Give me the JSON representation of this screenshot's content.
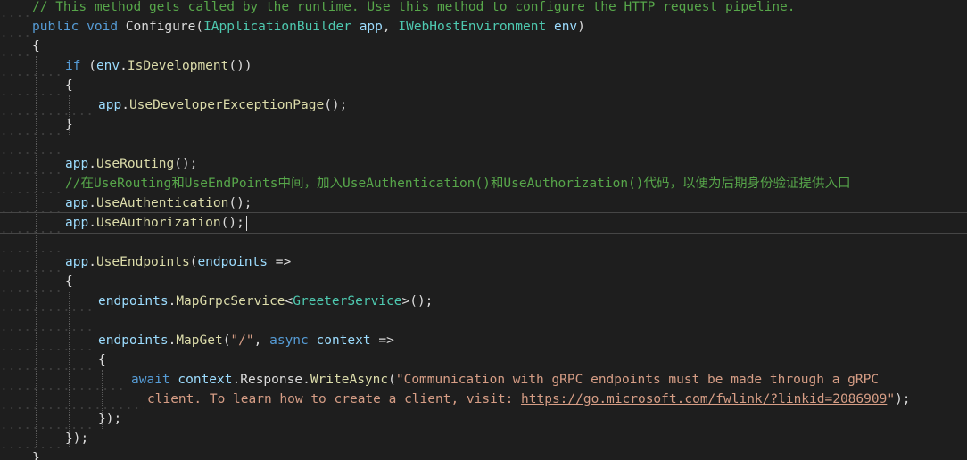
{
  "editor": {
    "lines": [
      {
        "tokens": [
          {
            "t": "// This method gets called by the runtime. Use this method to configure the HTTP request pipeline.",
            "c": "cmt"
          }
        ]
      },
      {
        "tokens": [
          {
            "t": "public",
            "c": "kw"
          },
          {
            "t": " ",
            "c": "punc"
          },
          {
            "t": "void",
            "c": "kw"
          },
          {
            "t": " Configure(",
            "c": "punc"
          },
          {
            "t": "IApplicationBuilder",
            "c": "type"
          },
          {
            "t": " ",
            "c": "punc"
          },
          {
            "t": "app",
            "c": "param"
          },
          {
            "t": ", ",
            "c": "punc"
          },
          {
            "t": "IWebHostEnvironment",
            "c": "type"
          },
          {
            "t": " ",
            "c": "punc"
          },
          {
            "t": "env",
            "c": "param"
          },
          {
            "t": ")",
            "c": "punc"
          }
        ]
      },
      {
        "tokens": [
          {
            "t": "{",
            "c": "punc"
          }
        ]
      },
      {
        "tokens": [
          {
            "t": "if",
            "c": "kw"
          },
          {
            "t": " (",
            "c": "punc"
          },
          {
            "t": "env",
            "c": "param"
          },
          {
            "t": ".",
            "c": "punc"
          },
          {
            "t": "IsDevelopment",
            "c": "method"
          },
          {
            "t": "())",
            "c": "punc"
          }
        ]
      },
      {
        "tokens": [
          {
            "t": "{",
            "c": "punc"
          }
        ]
      },
      {
        "tokens": [
          {
            "t": "app",
            "c": "param"
          },
          {
            "t": ".",
            "c": "punc"
          },
          {
            "t": "UseDeveloperExceptionPage",
            "c": "method"
          },
          {
            "t": "();",
            "c": "punc"
          }
        ]
      },
      {
        "tokens": [
          {
            "t": "}",
            "c": "punc"
          }
        ]
      },
      {
        "tokens": []
      },
      {
        "tokens": [
          {
            "t": "app",
            "c": "param"
          },
          {
            "t": ".",
            "c": "punc"
          },
          {
            "t": "UseRouting",
            "c": "method"
          },
          {
            "t": "();",
            "c": "punc"
          }
        ]
      },
      {
        "tokens": [
          {
            "t": "//在UseRouting和UseEndPoints中间，加入UseAuthentication()和UseAuthorization()代码，以便为后期身份验证提供入口",
            "c": "cmt"
          }
        ]
      },
      {
        "tokens": [
          {
            "t": "app",
            "c": "param"
          },
          {
            "t": ".",
            "c": "punc"
          },
          {
            "t": "UseAuthentication",
            "c": "method"
          },
          {
            "t": "();",
            "c": "punc"
          }
        ]
      },
      {
        "tokens": [
          {
            "t": "app",
            "c": "param"
          },
          {
            "t": ".",
            "c": "punc"
          },
          {
            "t": "UseAuthorization",
            "c": "method"
          },
          {
            "t": "();",
            "c": "punc"
          }
        ]
      },
      {
        "tokens": []
      },
      {
        "tokens": [
          {
            "t": "app",
            "c": "param"
          },
          {
            "t": ".",
            "c": "punc"
          },
          {
            "t": "UseEndpoints",
            "c": "method"
          },
          {
            "t": "(",
            "c": "punc"
          },
          {
            "t": "endpoints",
            "c": "param"
          },
          {
            "t": " =>",
            "c": "punc"
          }
        ]
      },
      {
        "tokens": [
          {
            "t": "{",
            "c": "punc"
          }
        ]
      },
      {
        "tokens": [
          {
            "t": "endpoints",
            "c": "param"
          },
          {
            "t": ".",
            "c": "punc"
          },
          {
            "t": "MapGrpcService",
            "c": "method"
          },
          {
            "t": "<",
            "c": "punc"
          },
          {
            "t": "GreeterService",
            "c": "type"
          },
          {
            "t": ">();",
            "c": "punc"
          }
        ]
      },
      {
        "tokens": []
      },
      {
        "tokens": [
          {
            "t": "endpoints",
            "c": "param"
          },
          {
            "t": ".",
            "c": "punc"
          },
          {
            "t": "MapGet",
            "c": "method"
          },
          {
            "t": "(",
            "c": "punc"
          },
          {
            "t": "\"/\"",
            "c": "str"
          },
          {
            "t": ", ",
            "c": "punc"
          },
          {
            "t": "async",
            "c": "kw"
          },
          {
            "t": " ",
            "c": "punc"
          },
          {
            "t": "context",
            "c": "param"
          },
          {
            "t": " =>",
            "c": "punc"
          }
        ]
      },
      {
        "tokens": [
          {
            "t": "{",
            "c": "punc"
          }
        ]
      },
      {
        "tokens": [
          {
            "t": "await",
            "c": "kw"
          },
          {
            "t": " ",
            "c": "punc"
          },
          {
            "t": "context",
            "c": "param"
          },
          {
            "t": ".Response.",
            "c": "punc"
          },
          {
            "t": "WriteAsync",
            "c": "method"
          },
          {
            "t": "(",
            "c": "punc"
          },
          {
            "t": "\"Communication with gRPC endpoints must be made through a gRPC",
            "c": "str"
          }
        ]
      },
      {
        "tokens": [
          {
            "t": "client. To learn how to create a client, visit: ",
            "c": "str"
          },
          {
            "t": "https://go.microsoft.com/fwlink/?linkid=2086909",
            "c": "link"
          },
          {
            "t": "\"",
            "c": "str"
          },
          {
            "t": ");",
            "c": "punc"
          }
        ]
      },
      {
        "tokens": [
          {
            "t": "});",
            "c": "punc"
          }
        ]
      },
      {
        "tokens": [
          {
            "t": "});",
            "c": "punc"
          }
        ]
      },
      {
        "tokens": [
          {
            "t": "}",
            "c": "punc"
          }
        ]
      }
    ]
  }
}
